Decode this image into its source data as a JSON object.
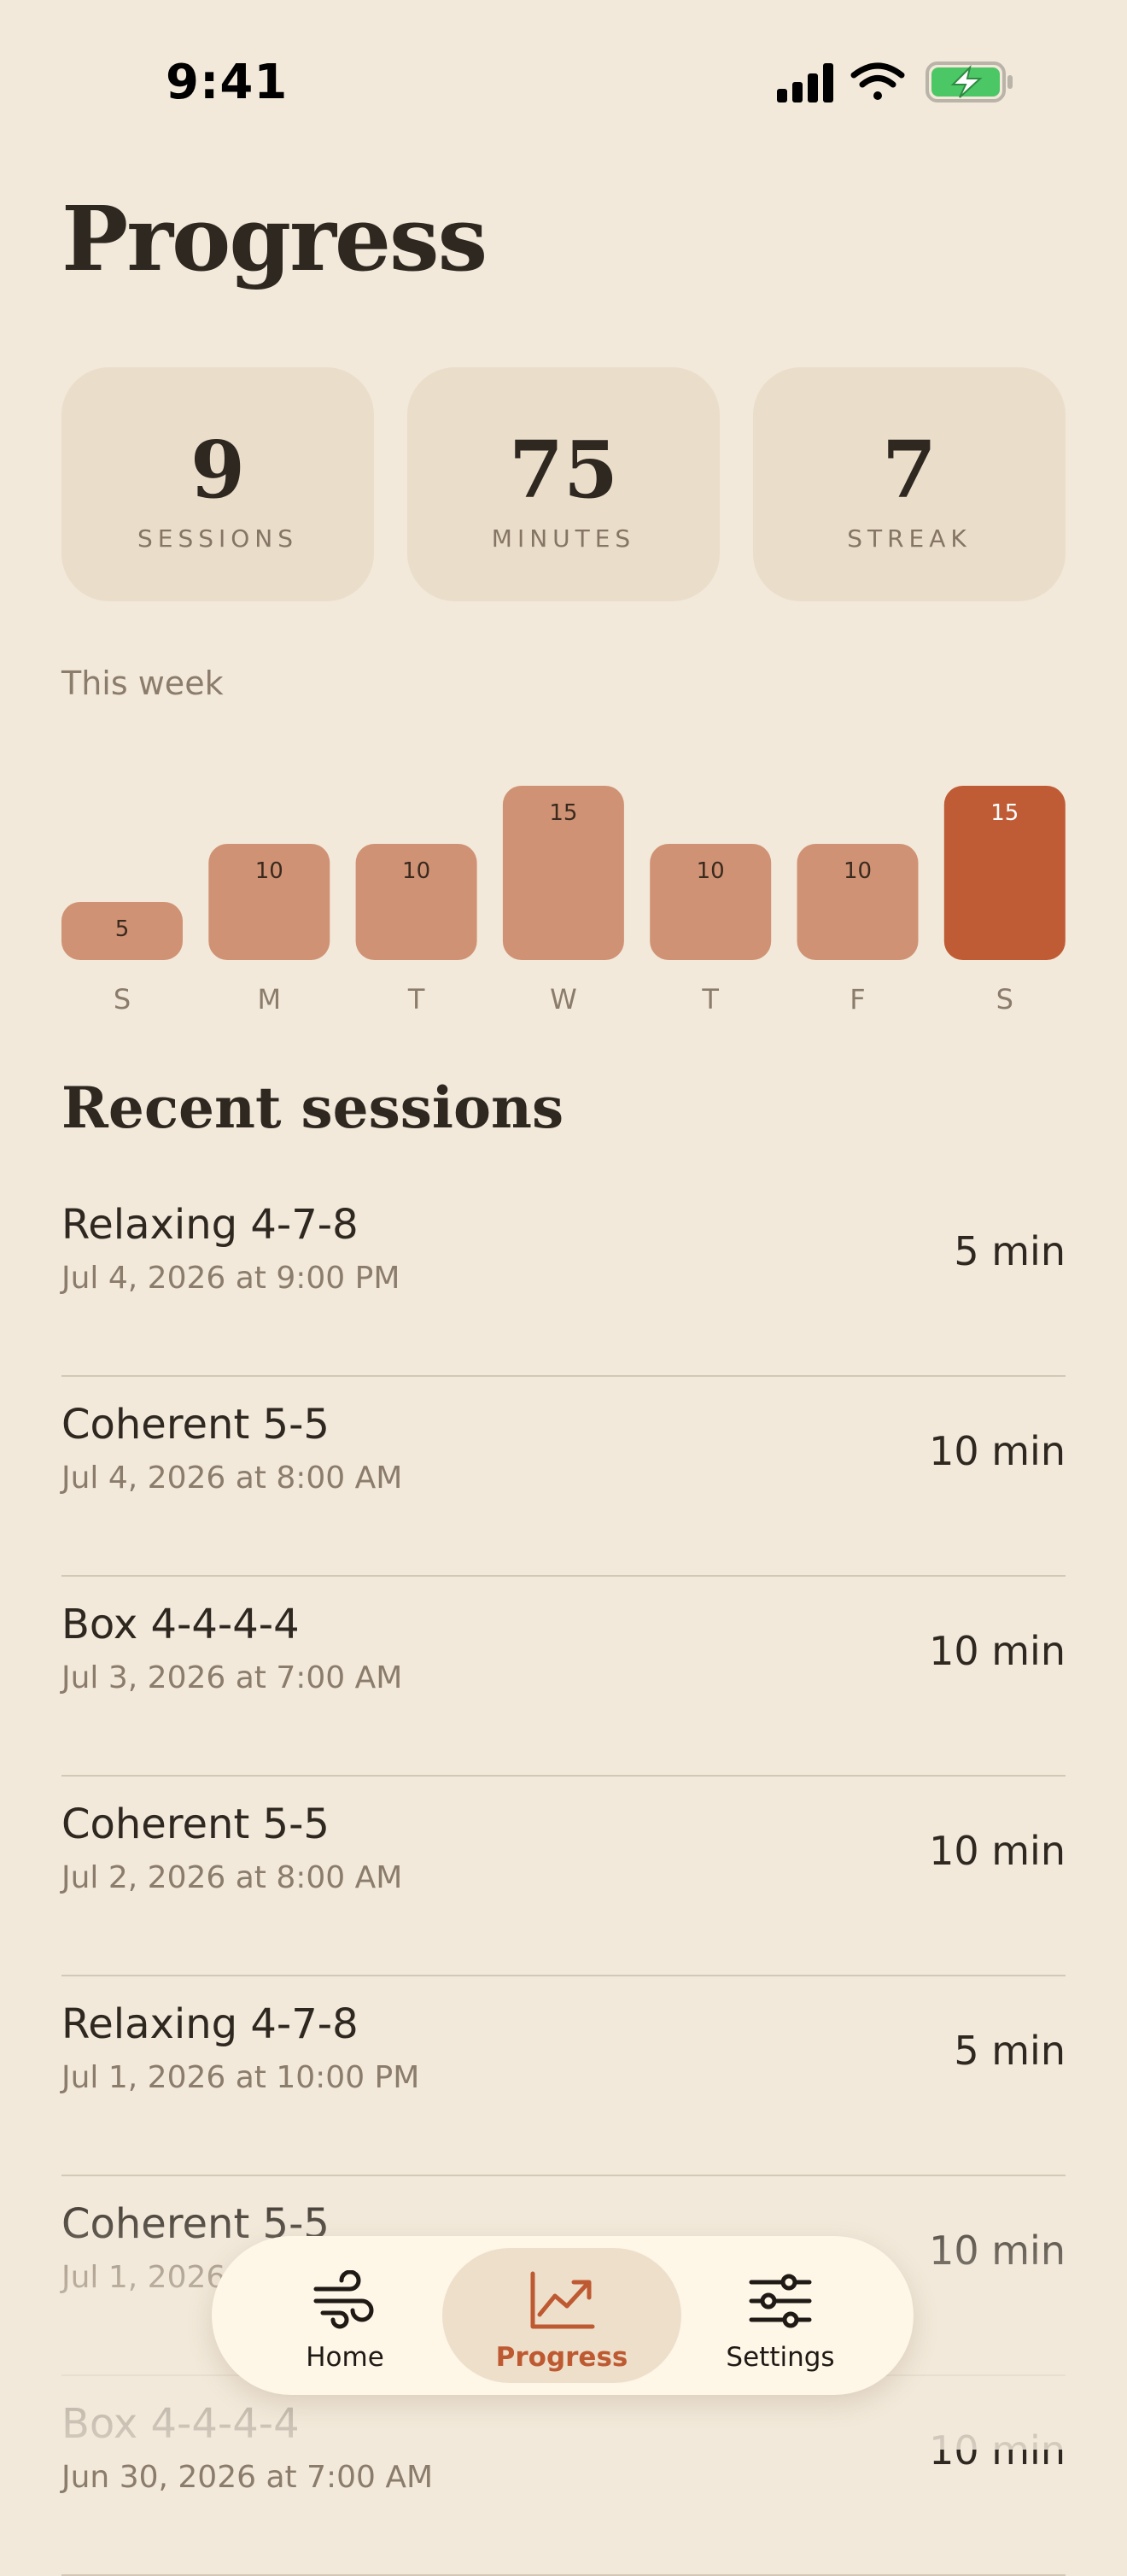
{
  "status": {
    "time": "9:41"
  },
  "title": "Progress",
  "stats": [
    {
      "value": "9",
      "label": "SESSIONS"
    },
    {
      "value": "75",
      "label": "MINUTES"
    },
    {
      "value": "7",
      "label": "STREAK"
    }
  ],
  "week": {
    "label": "This week"
  },
  "chart_data": {
    "type": "bar",
    "categories": [
      "S",
      "M",
      "T",
      "W",
      "T",
      "F",
      "S"
    ],
    "values": [
      5,
      10,
      10,
      15,
      10,
      10,
      15
    ],
    "highlight_index": 6,
    "ylim": [
      0,
      15
    ],
    "bar_color": "#D09274",
    "highlight_color": "#BF5C35"
  },
  "recent": {
    "title": "Recent sessions",
    "items": [
      {
        "name": "Relaxing 4-7-8",
        "date": "Jul 4, 2026 at 9:00 PM",
        "duration": "5 min"
      },
      {
        "name": "Coherent 5-5",
        "date": "Jul 4, 2026 at 8:00 AM",
        "duration": "10 min"
      },
      {
        "name": "Box 4-4-4-4",
        "date": "Jul 3, 2026 at 7:00 AM",
        "duration": "10 min"
      },
      {
        "name": "Coherent 5-5",
        "date": "Jul 2, 2026 at 8:00 AM",
        "duration": "10 min"
      },
      {
        "name": "Relaxing 4-7-8",
        "date": "Jul 1, 2026 at 10:00 PM",
        "duration": "5 min"
      },
      {
        "name": "Coherent 5-5",
        "date": "Jul 1, 2026 at 8:00 AM",
        "duration": "10 min"
      },
      {
        "name": "Box 4-4-4-4",
        "date": "Jun 30, 2026 at 7:00 AM",
        "duration": "10 min"
      }
    ]
  },
  "tabs": [
    {
      "label": "Home",
      "icon": "wind-icon",
      "active": false
    },
    {
      "label": "Progress",
      "icon": "chart-trend-icon",
      "active": true
    },
    {
      "label": "Settings",
      "icon": "sliders-icon",
      "active": false
    }
  ],
  "colors": {
    "background": "#F2E9DA",
    "accent": "#BE5A32",
    "battery": "#4CC765"
  }
}
